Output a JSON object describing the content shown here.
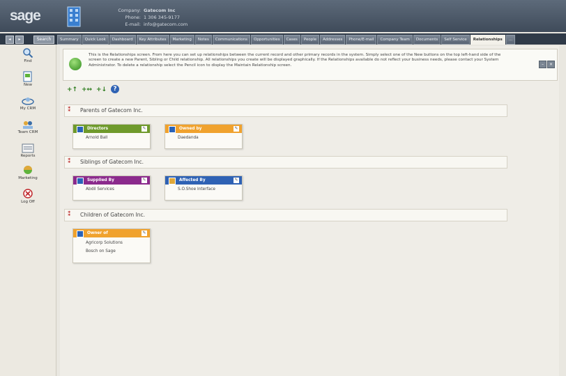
{
  "header": {
    "logo": "sage",
    "company_label": "Company:",
    "company_name": "Gatecom Inc",
    "phone_label": "Phone:",
    "phone": "1 306 345-9177",
    "email_label": "E-mail:",
    "email": "info@gatecom.com"
  },
  "nav_buttons": {
    "back": "◂",
    "forward": "▸",
    "search": "Search"
  },
  "tabs": [
    "Summary",
    "Quick Look",
    "Dashboard",
    "Key Attributes",
    "Marketing",
    "Notes",
    "Communications",
    "Opportunities",
    "Cases",
    "People",
    "Addresses",
    "Phone/E-mail",
    "Company Team",
    "Documents",
    "Self Service",
    "Relationships",
    "..."
  ],
  "active_tab": "Relationships",
  "left_nav": [
    "Find",
    "New",
    "My CRM",
    "Team CRM",
    "Reports",
    "Marketing",
    "Log Off"
  ],
  "info": {
    "text": "This is the Relationships screen. From here you can set up relationships between the current record and other primary records in the system. Simply select one of the New buttons on the top left-hand side of the screen to create a new Parent, Sibling or Child relationship. All relationships you create will be displayed graphically. If the Relationships available do not reflect your business needs, please contact your System Administrator. To delete a relationship select the Pencil icon to display the Maintain Relationship screen."
  },
  "sections": {
    "parents": "Parents of Gatecom Inc.",
    "siblings": "Siblings of Gatecom Inc.",
    "children": "Children of Gatecom Inc."
  },
  "cards": {
    "directors": {
      "title": "Directors",
      "values": [
        "Arnold Ball"
      ],
      "color": "#6f9a2c"
    },
    "owned_by": {
      "title": "Owned by",
      "values": [
        "Daedanda"
      ],
      "color": "#f0a22e"
    },
    "supplied_by": {
      "title": "Supplied By",
      "values": [
        "Abdil Services"
      ],
      "color": "#8b2a8c"
    },
    "affected_by": {
      "title": "Affected By",
      "values": [
        "S.O.Shoe Interface"
      ],
      "color": "#2f62b4"
    },
    "owner_of": {
      "title": "Owner of",
      "values": [
        "Agricorp Solutions",
        "Bosch on Sage"
      ],
      "color": "#f0a22e"
    }
  }
}
